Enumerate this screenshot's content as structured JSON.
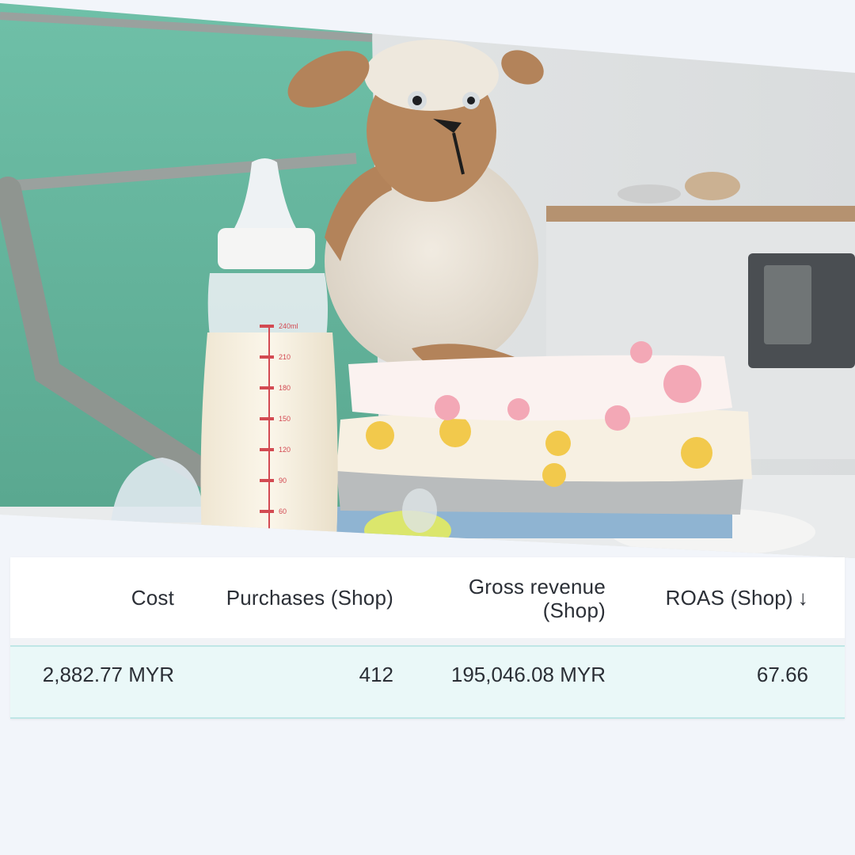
{
  "photo": {
    "subject": "baby-essentials-photo",
    "bottle_markings": [
      "240ml",
      "210",
      "180",
      "150",
      "120",
      "90",
      "60"
    ]
  },
  "table": {
    "headers": {
      "cost": "Cost",
      "purchases": "Purchases (Shop)",
      "gross_revenue_line1": "Gross revenue",
      "gross_revenue_line2": "(Shop)",
      "roas": "ROAS (Shop)",
      "sort_icon": "↓"
    },
    "row": {
      "cost": "2,882.77 MYR",
      "purchases": "412",
      "gross_revenue": "195,046.08 MYR",
      "roas": "67.66"
    }
  },
  "colors": {
    "page_bg": "#f2f5fa",
    "row_bg": "#eaf8f8",
    "row_border": "#bfe6e6",
    "text": "#2b2f36"
  }
}
